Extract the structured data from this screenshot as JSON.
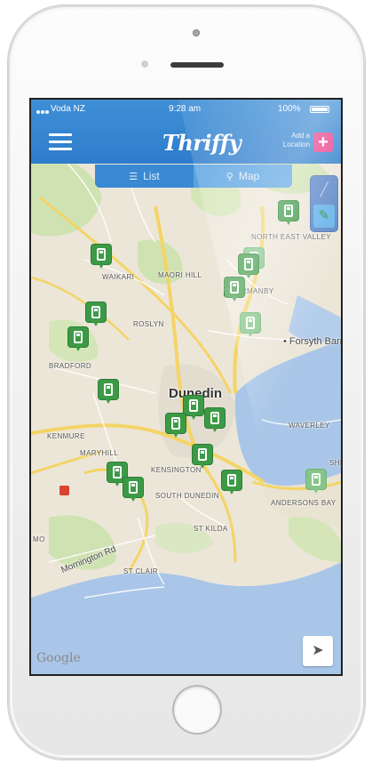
{
  "status_bar": {
    "carrier": "Voda NZ",
    "time": "9:28 am",
    "battery": "100%"
  },
  "header": {
    "logo": "Thriffy",
    "add_location_label": "Add a Location",
    "add_button": "+"
  },
  "tabs": [
    {
      "label": "List",
      "icon": "list-icon"
    },
    {
      "label": "Map",
      "icon": "map-pin-icon"
    }
  ],
  "map": {
    "places": {
      "north_east_valley": "NORTH EAST VALLEY",
      "waikari": "WAIKARI",
      "maori_hill": "MAORI HILL",
      "normanby": "NORMANBY",
      "roslyn": "ROSLYN",
      "forsyth_barr": "Forsyth Barr",
      "bradford": "BRADFORD",
      "dunedin": "Dunedin",
      "kenmure": "KENMURE",
      "waverley": "WAVERLEY",
      "maryhill": "MARYHILL",
      "kensington": "KENSINGTON",
      "south_dunedin": "SOUTH DUNEDIN",
      "andersons_bay": "ANDERSONS BAY",
      "shiel_hill": "SHIE",
      "st_kilda": "ST KILDA",
      "mornington_rd": "Mornington Rd",
      "st_clair": "ST CLAIR",
      "mo": "MO"
    },
    "google_label": "Google",
    "colors": {
      "water": "#a9c6e8",
      "land": "#ece6d8",
      "park": "#cfe2b2",
      "road_major": "#f4d466",
      "pin": "#3c9a46",
      "header": "#2d7dcc",
      "add_button": "#e83e8c"
    }
  },
  "locate_icon": "navigation-arrow-icon"
}
